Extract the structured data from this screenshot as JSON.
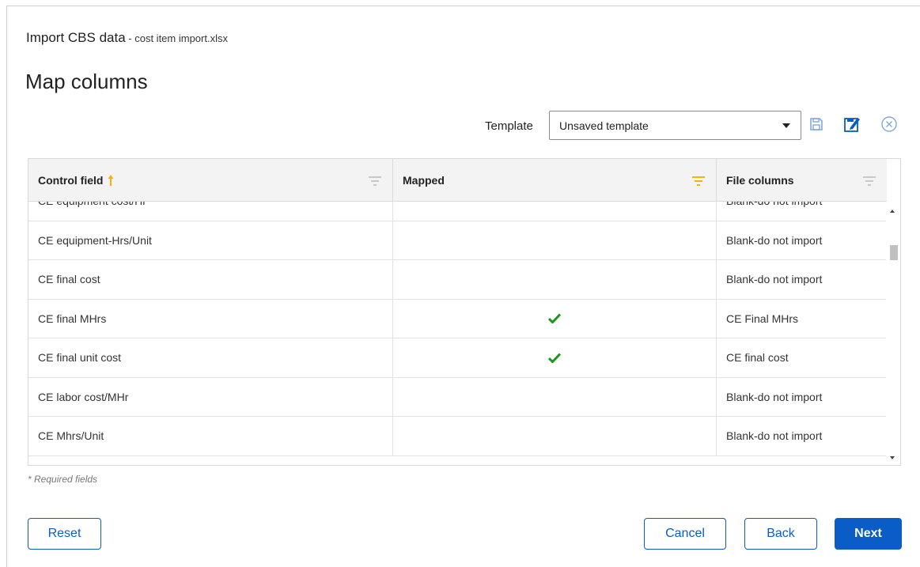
{
  "header": {
    "title": "Import CBS data",
    "subtitle": " - cost item import.xlsx",
    "page_title": "Map columns"
  },
  "template": {
    "label": "Template",
    "selected": "Unsaved template",
    "icons": [
      "save-icon",
      "edit-template-icon",
      "clear-icon"
    ]
  },
  "grid": {
    "columns": [
      {
        "label": "Control field",
        "sorted": "ascending",
        "filter_active": false
      },
      {
        "label": "Mapped",
        "filter_active": true
      },
      {
        "label": "File columns",
        "filter_active": false
      }
    ],
    "rows": [
      {
        "field": "CE equipment cost/Hr",
        "mapped": false,
        "file_column": "Blank-do not import"
      },
      {
        "field": "CE equipment-Hrs/Unit",
        "mapped": false,
        "file_column": "Blank-do not import"
      },
      {
        "field": "CE final cost",
        "mapped": false,
        "file_column": "Blank-do not import"
      },
      {
        "field": "CE final MHrs",
        "mapped": true,
        "file_column": "CE Final MHrs"
      },
      {
        "field": "CE final unit cost",
        "mapped": true,
        "file_column": "CE final cost"
      },
      {
        "field": "CE labor cost/MHr",
        "mapped": false,
        "file_column": "Blank-do not import"
      },
      {
        "field": "CE Mhrs/Unit",
        "mapped": false,
        "file_column": "Blank-do not import"
      }
    ]
  },
  "footer": {
    "required_note": "* Required fields",
    "reset_label": "Reset",
    "cancel_label": "Cancel",
    "back_label": "Back",
    "next_label": "Next"
  },
  "colors": {
    "accent": "#0a5cc7",
    "sort_arrow": "#f5b400",
    "filter_active": "#f5b400",
    "check": "#1a9a1a"
  }
}
